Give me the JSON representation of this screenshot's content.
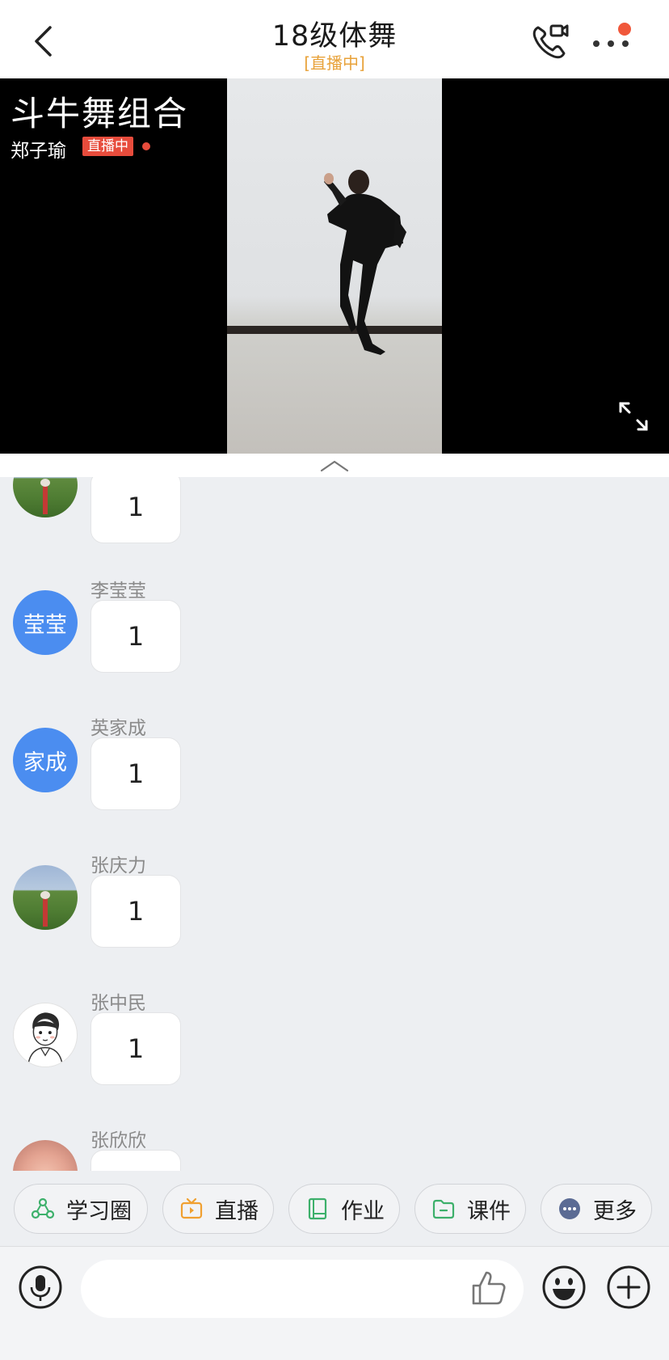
{
  "header": {
    "title": "18级体舞",
    "subtitle": "[直播中]",
    "icons": {
      "back": "chevron-left-icon",
      "call": "phone-video-icon",
      "more": "more-dots-icon"
    },
    "accent_color": "#e8a23a",
    "notification_dot_color": "#f0573a"
  },
  "live": {
    "title": "斗牛舞组合",
    "host": "郑子瑜",
    "badge": "直播中",
    "badge_color": "#e74c3c"
  },
  "messages": [
    {
      "sender": "",
      "text": "1",
      "avatar": "field-photo"
    },
    {
      "sender": "李莹莹",
      "text": "1",
      "avatar_text": "莹莹"
    },
    {
      "sender": "英家成",
      "text": "1",
      "avatar_text": "家成"
    },
    {
      "sender": "张庆力",
      "text": "1",
      "avatar": "field-photo"
    },
    {
      "sender": "张中民",
      "text": "1",
      "avatar": "cartoon-boy"
    },
    {
      "sender": "张欣欣",
      "text": "",
      "avatar": "photo"
    }
  ],
  "quick_tabs": [
    {
      "label": "学习圈",
      "icon": "study-circle-icon",
      "color": "#3db06b"
    },
    {
      "label": "直播",
      "icon": "live-tv-icon",
      "color": "#f0a030"
    },
    {
      "label": "作业",
      "icon": "homework-book-icon",
      "color": "#3db06b"
    },
    {
      "label": "课件",
      "icon": "courseware-folder-icon",
      "color": "#3db06b"
    },
    {
      "label": "更多",
      "icon": "more-circle-icon",
      "color": "#5b6b94"
    }
  ],
  "input": {
    "placeholder": "",
    "icons": {
      "voice": "microphone-icon",
      "like": "thumbs-up-icon",
      "emoji": "emoji-icon",
      "plus": "plus-icon"
    }
  }
}
